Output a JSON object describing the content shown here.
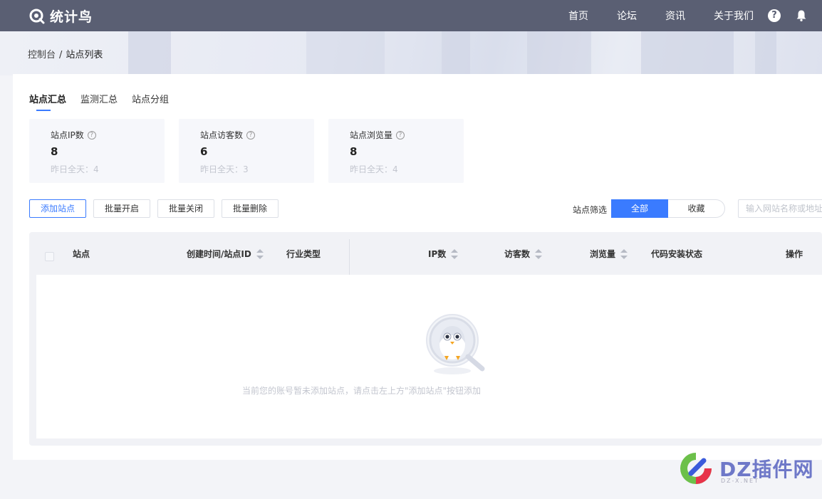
{
  "header": {
    "app_name": "统计鸟",
    "nav": [
      "首页",
      "论坛",
      "资讯",
      "关于我们"
    ],
    "help_glyph": "?"
  },
  "breadcrumb": {
    "root": "控制台",
    "separator": "/",
    "current": "站点列表"
  },
  "tabs": [
    "站点汇总",
    "监测汇总",
    "站点分组"
  ],
  "active_tab": "站点汇总",
  "stats": [
    {
      "label": "站点IP数",
      "value": "8",
      "sub": "昨日全天：4"
    },
    {
      "label": "站点访客数",
      "value": "6",
      "sub": "昨日全天：3"
    },
    {
      "label": "站点浏览量",
      "value": "8",
      "sub": "昨日全天：4"
    }
  ],
  "actions": {
    "add": "添加站点",
    "batch_enable": "批量开启",
    "batch_disable": "批量关闭",
    "batch_delete": "批量删除"
  },
  "filter": {
    "label": "站点筛选",
    "options": [
      "全部",
      "收藏"
    ],
    "selected": "全部",
    "search_placeholder": "输入网站名称或地址"
  },
  "table": {
    "columns": {
      "site": "站点",
      "created": "创建时间/站点ID",
      "industry": "行业类型",
      "ip": "IP数",
      "visitors": "访客数",
      "pageviews": "浏览量",
      "code_status": "代码安装状态",
      "ops": "操作"
    },
    "rows": [],
    "empty_text": "当前您的账号暂未添加站点，请点击左上方\"添加站点\"按钮添加"
  },
  "watermark": {
    "brand": "DZ插件网",
    "domain": "DZ-X.NET"
  },
  "colors": {
    "header_bg": "#5a5f73",
    "accent": "#3a7bff",
    "muted_text": "#c3c6cf"
  }
}
